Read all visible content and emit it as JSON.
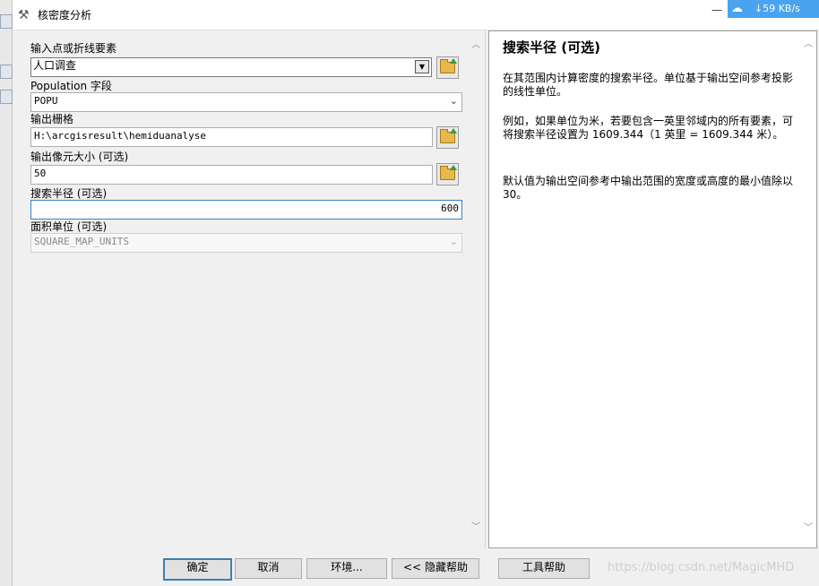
{
  "window": {
    "title": "核密度分析",
    "minimize_glyph": "—"
  },
  "network_badge": {
    "speed": "59 KB/s",
    "arrow": "↓"
  },
  "form": {
    "input_features": {
      "label": "输入点或折线要素",
      "value": "人口调查"
    },
    "population_field": {
      "label": "Population 字段",
      "value": "POPU"
    },
    "output_raster": {
      "label": "输出栅格",
      "value": "H:\\arcgisresult\\hemiduanalyse"
    },
    "cell_size": {
      "label": "输出像元大小 (可选)",
      "value": "50"
    },
    "search_radius": {
      "label": "搜索半径 (可选)",
      "value": "600"
    },
    "area_units": {
      "label": "面积单位 (可选)",
      "value": "SQUARE_MAP_UNITS"
    }
  },
  "help": {
    "title": "搜索半径 (可选)",
    "para1": "在其范围内计算密度的搜索半径。单位基于输出空间参考投影的线性单位。",
    "para2": "例如，如果单位为米，若要包含一英里邻域内的所有要素，可将搜索半径设置为 1609.344（1 英里 = 1609.344 米）。",
    "para3": "默认值为输出空间参考中输出范围的宽度或高度的最小值除以 30。"
  },
  "buttons": {
    "ok": "确定",
    "cancel": "取消",
    "environments": "环境...",
    "hide_help": "<< 隐藏帮助",
    "tool_help": "工具帮助"
  },
  "watermark": "https://blog.csdn.net/MagicMHD",
  "icons": {
    "title": "hammer-icon",
    "browse": "folder-open-icon",
    "network": "cloud-download-icon"
  },
  "colors": {
    "focus_border": "#3b7fc4",
    "badge_bg": "#4aa3ee",
    "default_button_border": "#3c7fb1"
  }
}
